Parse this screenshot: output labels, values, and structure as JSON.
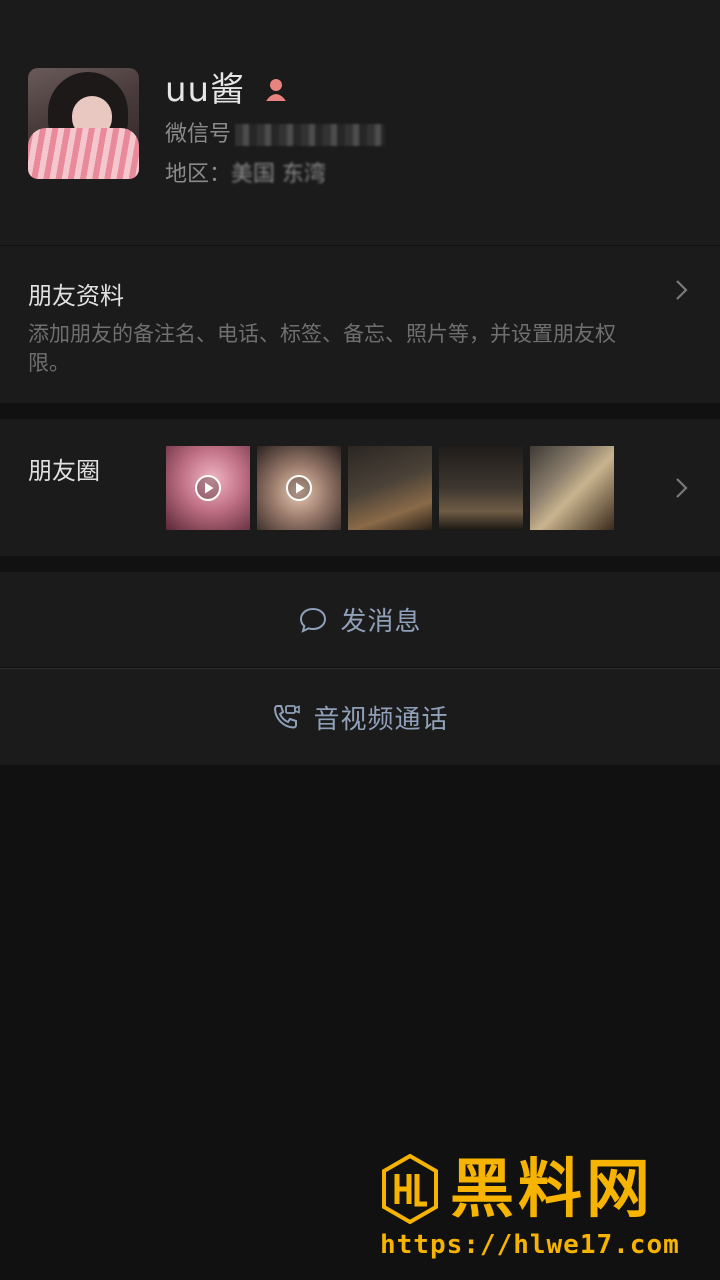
{
  "profile": {
    "name": "uu酱",
    "wechat_id_label": "微信号",
    "region_label": "地区：",
    "region_value": "美国 东湾",
    "gender_icon": "female-person-icon"
  },
  "friend_info": {
    "title": "朋友资料",
    "description": "添加朋友的备注名、电话、标签、备忘、照片等，并设置朋友权限。"
  },
  "moments": {
    "title": "朋友圈",
    "thumbnails": [
      {
        "kind": "video"
      },
      {
        "kind": "video"
      },
      {
        "kind": "photo"
      },
      {
        "kind": "photo"
      },
      {
        "kind": "photo"
      }
    ]
  },
  "actions": {
    "send_message": "发消息",
    "av_call": "音视频通话"
  },
  "watermark": {
    "title": "黑料网",
    "url": "https://hlwe17.com"
  },
  "colors": {
    "background": "#111111",
    "panel": "#1b1b1b",
    "action_text": "#8fa0b8",
    "watermark": "#f6b400",
    "gender_icon": "#e8837f"
  }
}
